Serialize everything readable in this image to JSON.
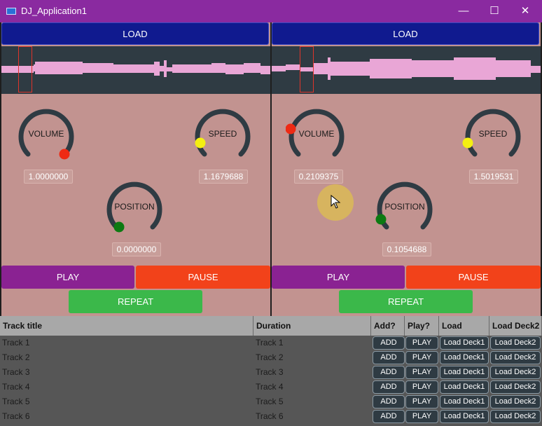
{
  "window": {
    "title": "DJ_Application1",
    "minimize": "—",
    "maximize": "☐",
    "close": "✕"
  },
  "colors": {
    "titlebar": "#8a2aa0",
    "deck_bg": "#c29390",
    "load": "#101a8f",
    "play": "#8a2292",
    "pause": "#f2421a",
    "repeat": "#3bb84a",
    "knob_track": "#2f3b43",
    "volume_dot": "#ee2a14",
    "speed_dot": "#f4ef12",
    "position_dot": "#0c7a12"
  },
  "deck1": {
    "load_label": "LOAD",
    "volume": {
      "label": "VOLUME",
      "value": "1.0000000"
    },
    "speed": {
      "label": "SPEED",
      "value": "1.1679688"
    },
    "position": {
      "label": "POSITION",
      "value": "0.0000000"
    },
    "play_label": "PLAY",
    "pause_label": "PAUSE",
    "repeat_label": "REPEAT"
  },
  "deck2": {
    "load_label": "LOAD",
    "volume": {
      "label": "VOLUME",
      "value": "0.2109375"
    },
    "speed": {
      "label": "SPEED",
      "value": "1.5019531"
    },
    "position": {
      "label": "POSITION",
      "value": "0.1054688"
    },
    "play_label": "PLAY",
    "pause_label": "PAUSE",
    "repeat_label": "REPEAT"
  },
  "playlist": {
    "headers": [
      "Track title",
      "Duration",
      "Add?",
      "Play?",
      "Load Deck1",
      "Load Deck2"
    ],
    "rows": [
      {
        "title": "Track 1",
        "duration": "Track 1",
        "add": "ADD",
        "play": "PLAY",
        "deck1": "Load Deck1",
        "deck2": "Load Deck2"
      },
      {
        "title": "Track 2",
        "duration": "Track 2",
        "add": "ADD",
        "play": "PLAY",
        "deck1": "Load Deck1",
        "deck2": "Load Deck2"
      },
      {
        "title": "Track 3",
        "duration": "Track 3",
        "add": "ADD",
        "play": "PLAY",
        "deck1": "Load Deck1",
        "deck2": "Load Deck2"
      },
      {
        "title": "Track 4",
        "duration": "Track 4",
        "add": "ADD",
        "play": "PLAY",
        "deck1": "Load Deck1",
        "deck2": "Load Deck2"
      },
      {
        "title": "Track 5",
        "duration": "Track 5",
        "add": "ADD",
        "play": "PLAY",
        "deck1": "Load Deck1",
        "deck2": "Load Deck2"
      },
      {
        "title": "Track 6",
        "duration": "Track 6",
        "add": "ADD",
        "play": "PLAY",
        "deck1": "Load Deck1",
        "deck2": "Load Deck2"
      }
    ]
  }
}
